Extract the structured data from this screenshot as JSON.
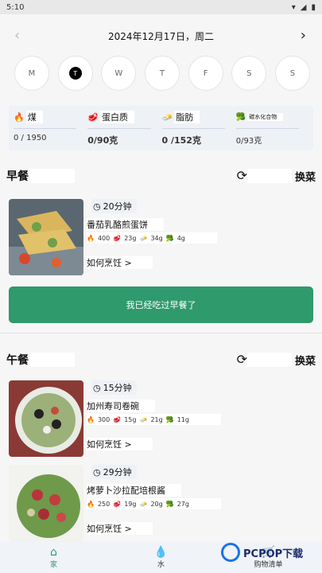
{
  "status": {
    "time": "5:10"
  },
  "date": {
    "prev": "‹",
    "label": "2024年12月17日，周二",
    "next": "›"
  },
  "days": [
    "M",
    "T",
    "W",
    "T",
    "F",
    "S",
    "S"
  ],
  "nutrition": [
    {
      "label": "煤",
      "value": "0 / 1950"
    },
    {
      "label": "蛋白质",
      "value": "0/90克"
    },
    {
      "label": "脂肪",
      "value": "0 /152克"
    },
    {
      "label": "碳水化合物",
      "value": "0/93克"
    }
  ],
  "breakfast": {
    "title": "早餐",
    "swap": "换菜",
    "meal": {
      "time": "20分钟",
      "name": "番茄乳酪煎蛋饼",
      "kcal": "400",
      "protein": "23g",
      "fat": "34g",
      "carb": "4g",
      "howto": "如何烹饪 >"
    },
    "ate_button": "我已经吃过早餐了"
  },
  "lunch": {
    "title": "午餐",
    "swap": "换菜",
    "meals": [
      {
        "time": "15分钟",
        "name": "加州寿司卷碗",
        "kcal": "300",
        "protein": "15g",
        "fat": "21g",
        "carb": "11g",
        "howto": "如何烹饪 >"
      },
      {
        "time": "29分钟",
        "name": "烤萝卜沙拉配培根酱",
        "kcal": "250",
        "protein": "19g",
        "fat": "20g",
        "carb": "27g",
        "howto": "如何烹饪 >"
      }
    ]
  },
  "tabs": [
    {
      "label": "家"
    },
    {
      "label": "水"
    },
    {
      "label": "购物清单"
    }
  ],
  "watermark": "PCPOP下载"
}
